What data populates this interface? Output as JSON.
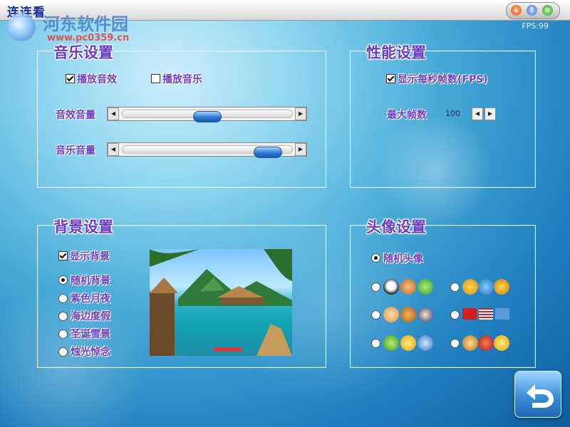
{
  "window": {
    "title": "连连看",
    "watermark_text": "河东软件园",
    "watermark_url": "www.pc0359.cn",
    "fps_readout": "FPS:99"
  },
  "music_panel": {
    "title": "音乐设置",
    "play_sound_effects": {
      "label": "播放音效",
      "checked": true
    },
    "play_music": {
      "label": "播放音乐",
      "checked": false
    },
    "effects_volume": {
      "label": "音效音量",
      "level": 0.5
    },
    "music_volume": {
      "label": "音乐音量",
      "level": 0.93
    }
  },
  "performance_panel": {
    "title": "性能设置",
    "show_fps": {
      "label": "显示每秒帧数(FPS)",
      "checked": true
    },
    "max_fps": {
      "label": "最大帧数",
      "value": "100"
    }
  },
  "background_panel": {
    "title": "背景设置",
    "show_background": {
      "label": "显示背景",
      "checked": true
    },
    "options": [
      {
        "label": "随机背景",
        "selected": true
      },
      {
        "label": "紫色月夜",
        "selected": false
      },
      {
        "label": "海边度假",
        "selected": false
      },
      {
        "label": "圣诞雪景",
        "selected": false
      },
      {
        "label": "烛光悼念",
        "selected": false
      }
    ]
  },
  "avatar_panel": {
    "title": "头像设置",
    "random_avatar": {
      "label": "随机头像",
      "selected": true
    },
    "sets": [
      {
        "name": "animals",
        "icons": [
          "panda-icon",
          "dog-icon",
          "frog-icon"
        ]
      },
      {
        "name": "tigers",
        "icons": [
          "tiger-icon",
          "tiger-icon",
          "tiger-icon"
        ]
      },
      {
        "name": "cartoon-kids",
        "icons": [
          "girl-icon",
          "horse-icon",
          "boy-icon"
        ]
      },
      {
        "name": "flags",
        "icons": [
          "china-flag-icon",
          "usa-flag-icon",
          "un-flag-icon"
        ]
      },
      {
        "name": "smileys",
        "icons": [
          "alien-icon",
          "smiley-icon",
          "fish-icon"
        ]
      },
      {
        "name": "pets",
        "icons": [
          "lion-icon",
          "ladybug-icon",
          "chick-icon"
        ]
      }
    ]
  },
  "colors": {
    "label_purple": "#6b3ec2",
    "title_blue": "#17319a"
  }
}
